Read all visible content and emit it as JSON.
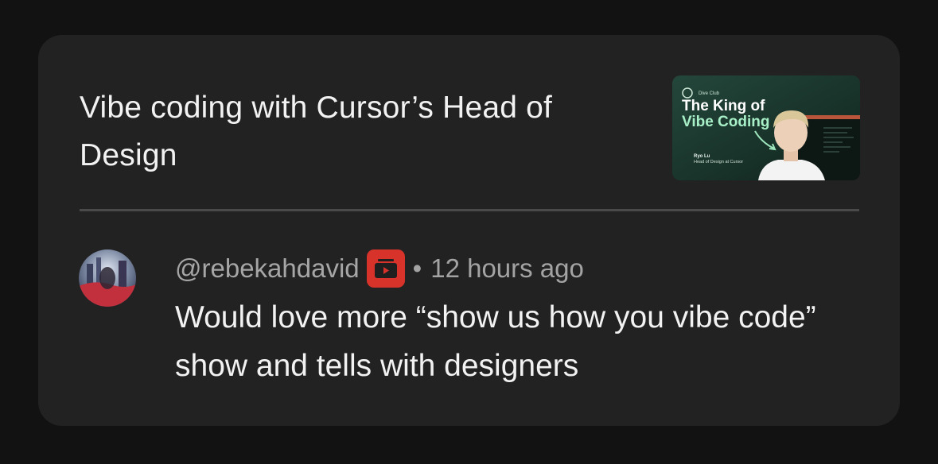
{
  "video": {
    "title": "Vibe coding with Cursor’s Head of Design",
    "thumbnail": {
      "brand": "Dive Club",
      "headline_line1": "The King of",
      "headline_line2": "Vibe Coding",
      "guest_name": "Ryo Lu",
      "guest_role": "Head of Design at Cursor"
    }
  },
  "comment": {
    "author": "@rebekahdavid",
    "badge_icon": "youtube-premium-icon",
    "separator": "•",
    "time_ago": "12 hours ago",
    "text": "Would love more “show us how you vibe code” show and tells with designers"
  },
  "colors": {
    "page_bg": "#121212",
    "card_bg": "#222222",
    "badge_red": "#d8332a",
    "thumb_green": "#1e3a31",
    "headline_mint": "#a8f0c8"
  }
}
